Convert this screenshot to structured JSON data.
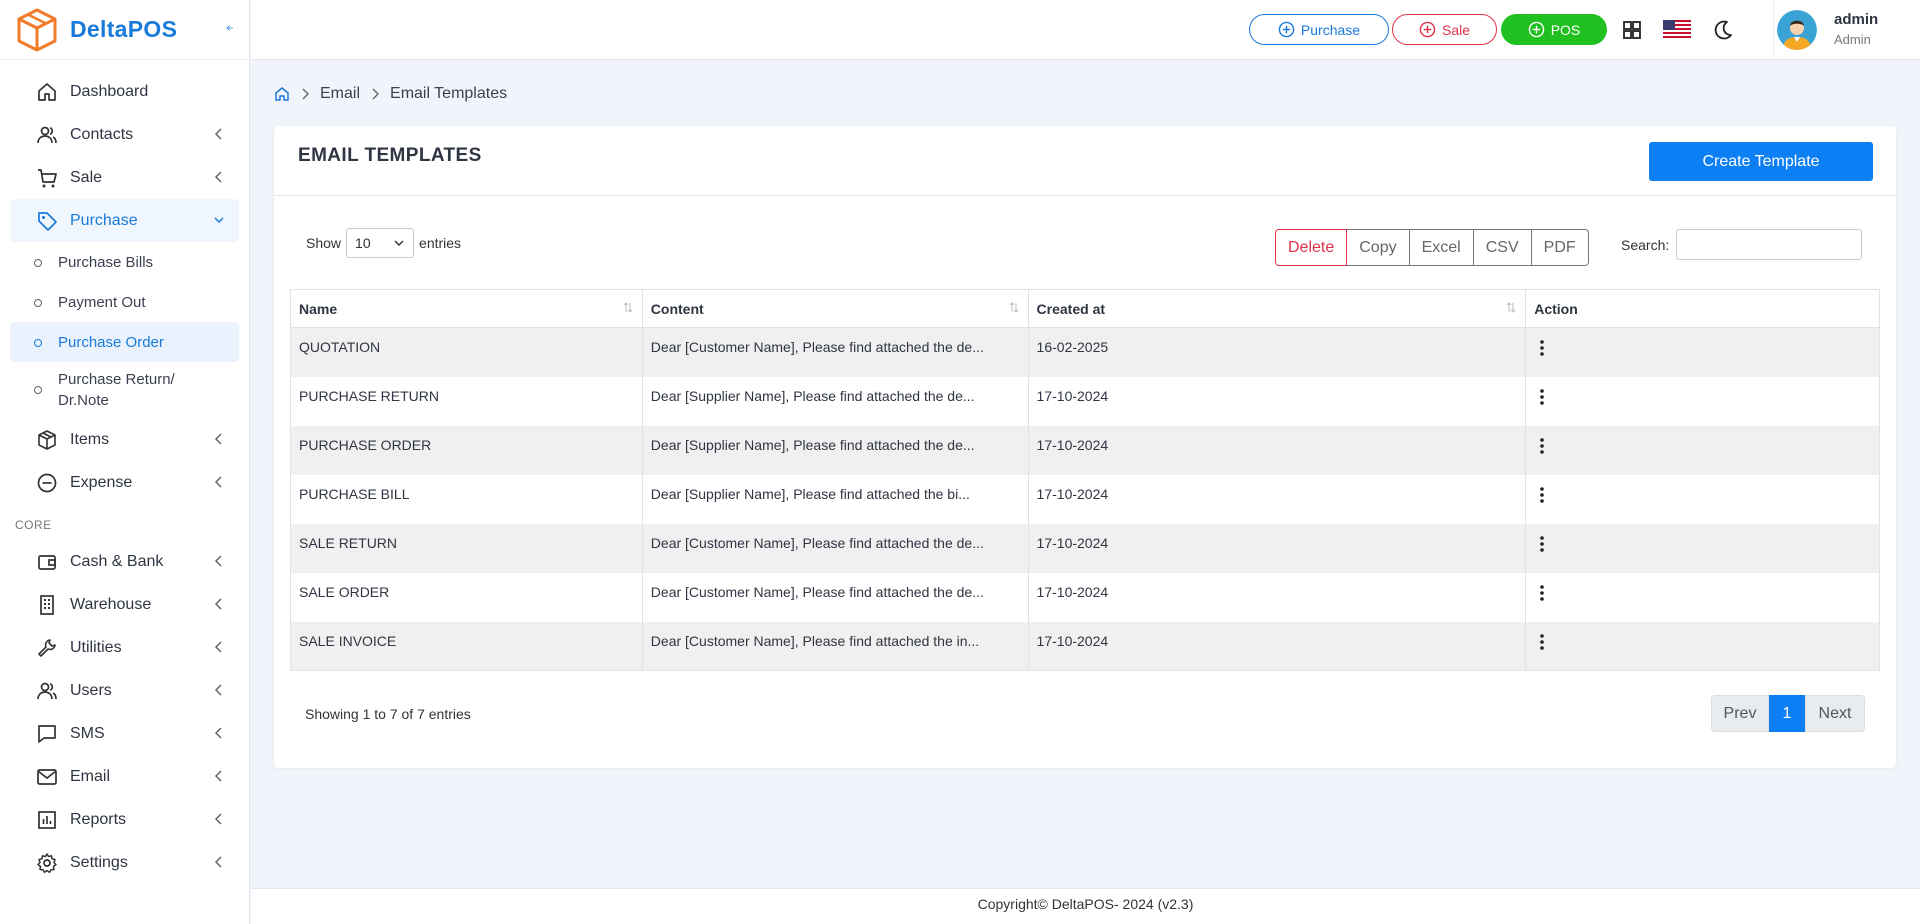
{
  "brand": {
    "name": "DeltaPOS"
  },
  "sidebar": {
    "items": [
      {
        "label": "Dashboard",
        "icon": "home-icon"
      },
      {
        "label": "Contacts",
        "icon": "users-icon"
      },
      {
        "label": "Sale",
        "icon": "cart-icon"
      },
      {
        "label": "Purchase",
        "icon": "tag-icon"
      }
    ],
    "purchase_sub": [
      {
        "label": "Purchase Bills"
      },
      {
        "label": "Payment Out"
      },
      {
        "label": "Purchase Order"
      },
      {
        "label": "Purchase Return/ Dr.Note"
      }
    ],
    "items2": [
      {
        "label": "Items",
        "icon": "box-icon"
      },
      {
        "label": "Expense",
        "icon": "minus-circle-icon"
      }
    ],
    "section_core": "CORE",
    "core_items": [
      {
        "label": "Cash & Bank",
        "icon": "wallet-icon"
      },
      {
        "label": "Warehouse",
        "icon": "building-icon"
      },
      {
        "label": "Utilities",
        "icon": "wrench-icon"
      },
      {
        "label": "Users",
        "icon": "users-icon"
      },
      {
        "label": "SMS",
        "icon": "chat-icon"
      },
      {
        "label": "Email",
        "icon": "mail-icon"
      },
      {
        "label": "Reports",
        "icon": "chart-icon"
      },
      {
        "label": "Settings",
        "icon": "gear-icon"
      }
    ]
  },
  "topbar": {
    "purchase_label": "Purchase",
    "sale_label": "Sale",
    "pos_label": "POS",
    "user_name": "admin",
    "user_role": "Admin"
  },
  "breadcrumb": {
    "level1": "Email",
    "level2": "Email Templates"
  },
  "card": {
    "title": "EMAIL TEMPLATES",
    "create_label": "Create Template",
    "show_label": "Show",
    "entries_label": "entries",
    "page_length": "10",
    "buttons": [
      "Delete",
      "Copy",
      "Excel",
      "CSV",
      "PDF"
    ],
    "search_label": "Search:",
    "search_value": ""
  },
  "table": {
    "headers": [
      "Name",
      "Content",
      "Created at",
      "Action"
    ],
    "rows": [
      {
        "name": "QUOTATION",
        "content": "Dear [Customer Name], Please find attached the de...",
        "created": "16-02-2025"
      },
      {
        "name": "PURCHASE RETURN",
        "content": "Dear [Supplier Name], Please find attached the de...",
        "created": "17-10-2024"
      },
      {
        "name": "PURCHASE ORDER",
        "content": "Dear [Supplier Name], Please find attached the de...",
        "created": "17-10-2024"
      },
      {
        "name": "PURCHASE BILL",
        "content": "Dear [Supplier Name], Please find attached the bi...",
        "created": "17-10-2024"
      },
      {
        "name": "SALE RETURN",
        "content": "Dear [Customer Name], Please find attached the de...",
        "created": "17-10-2024"
      },
      {
        "name": "SALE ORDER",
        "content": "Dear [Customer Name], Please find attached the de...",
        "created": "17-10-2024"
      },
      {
        "name": "SALE INVOICE",
        "content": "Dear [Customer Name], Please find attached the in...",
        "created": "17-10-2024"
      }
    ]
  },
  "pagination": {
    "info": "Showing 1 to 7 of 7 entries",
    "prev": "Prev",
    "current": "1",
    "next": "Next"
  },
  "footer": {
    "text": "Copyright© DeltaPOS- 2024 (v2.3)"
  },
  "colors": {
    "primary": "#0d7ff5",
    "brand": "#1a7ad9",
    "sale": "#e0334b",
    "pos": "#1fc01f"
  }
}
